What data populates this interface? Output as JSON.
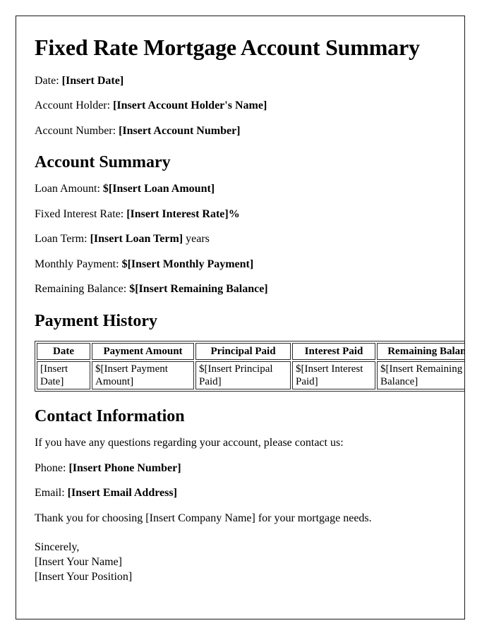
{
  "document": {
    "title": "Fixed Rate Mortgage Account Summary"
  },
  "header_fields": [
    {
      "label": "Date:",
      "value": "[Insert Date]"
    },
    {
      "label": "Account Holder:",
      "value": "[Insert Account Holder's Name]"
    },
    {
      "label": "Account Number:",
      "value": "[Insert Account Number]"
    }
  ],
  "account_summary": {
    "heading": "Account Summary",
    "fields": [
      {
        "label": "Loan Amount:",
        "value": "$[Insert Loan Amount]",
        "suffix": ""
      },
      {
        "label": "Fixed Interest Rate:",
        "value": "[Insert Interest Rate]%",
        "suffix": ""
      },
      {
        "label": "Loan Term:",
        "value": "[Insert Loan Term]",
        "suffix": " years"
      },
      {
        "label": "Monthly Payment:",
        "value": "$[Insert Monthly Payment]",
        "suffix": ""
      },
      {
        "label": "Remaining Balance:",
        "value": "$[Insert Remaining Balance]",
        "suffix": ""
      }
    ]
  },
  "payment_history": {
    "heading": "Payment History",
    "columns": [
      "Date",
      "Payment Amount",
      "Principal Paid",
      "Interest Paid",
      "Remaining Balance"
    ],
    "rows": [
      [
        "[Insert Date]",
        "$[Insert Payment Amount]",
        "$[Insert Principal Paid]",
        "$[Insert Interest Paid]",
        "$[Insert Remaining Balance]"
      ]
    ]
  },
  "contact_information": {
    "heading": "Contact Information",
    "intro": "If you have any questions regarding your account, please contact us:",
    "phone_label": "Phone:",
    "phone_value": "[Insert Phone Number]",
    "email_label": "Email:",
    "email_value": "[Insert Email Address]",
    "closing": "Thank you for choosing [Insert Company Name] for your mortgage needs."
  },
  "signature": {
    "salutation": "Sincerely,",
    "name": "[Insert Your Name]",
    "position": "[Insert Your Position]"
  }
}
